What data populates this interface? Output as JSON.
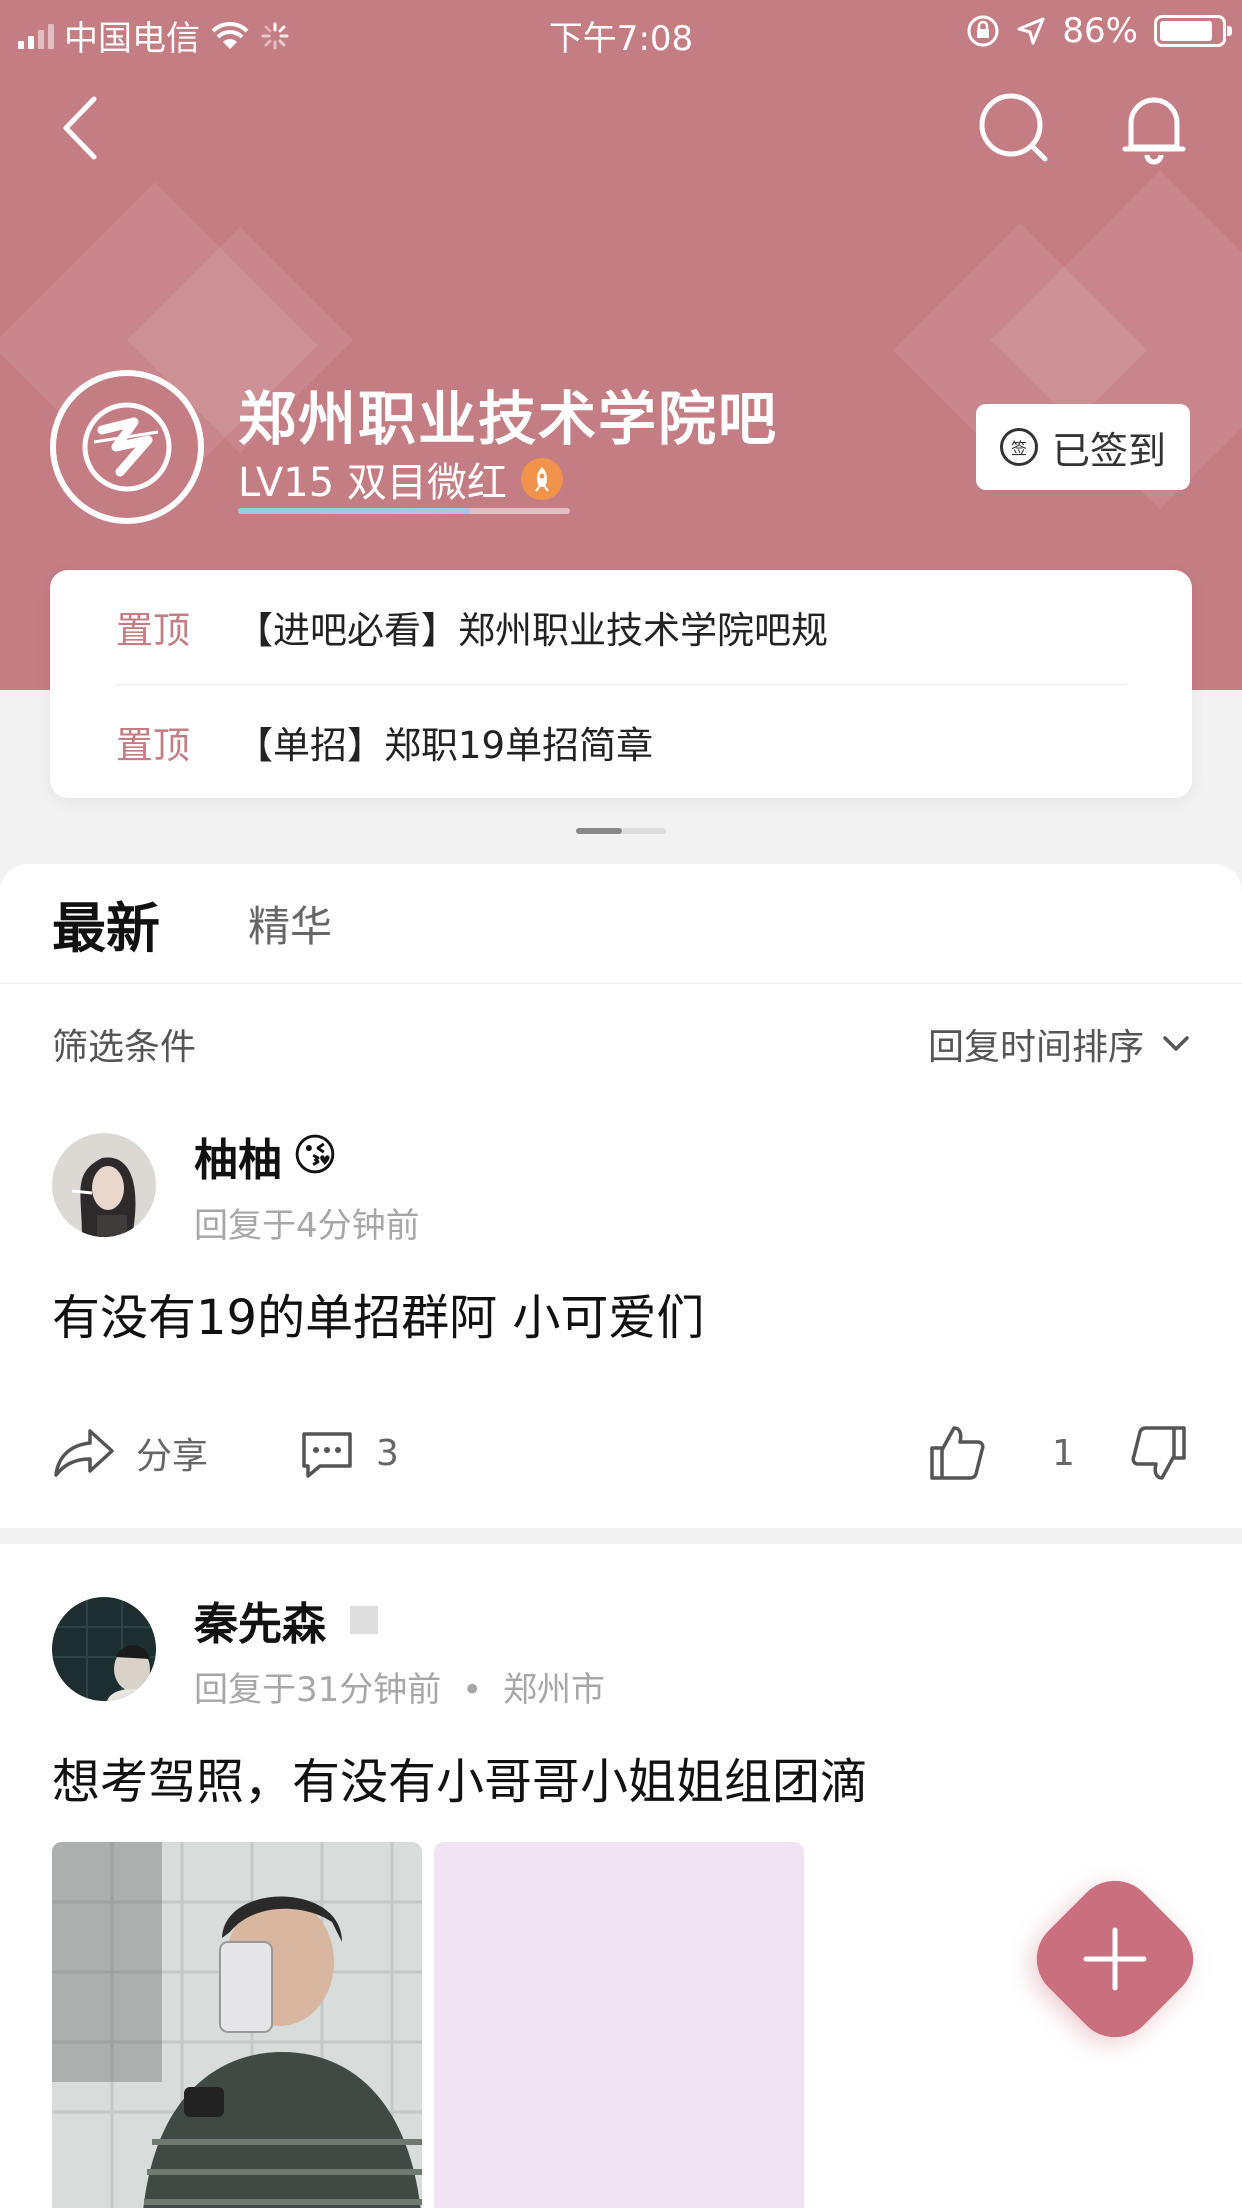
{
  "status_bar": {
    "carrier": "中国电信",
    "time": "下午7:08",
    "battery": "86%",
    "battery_level": 0.86
  },
  "forum": {
    "name": "郑州职业技术学院吧",
    "level": "LV15 双目微红",
    "level_progress": 0.7,
    "checkin_label": "已签到",
    "checkin_icon_char": "签"
  },
  "pinned": [
    {
      "tag": "置顶",
      "text": "【进吧必看】郑州职业技术学院吧规"
    },
    {
      "tag": "置顶",
      "text": "【单招】郑职19单招简章"
    }
  ],
  "tabs": [
    {
      "label": "最新",
      "active": true
    },
    {
      "label": "精华",
      "active": false
    }
  ],
  "filter": {
    "label": "筛选条件",
    "sort_label": "回复时间排序"
  },
  "posts": [
    {
      "username": "柚柚",
      "emoji": "😘",
      "meta": "回复于4分钟前",
      "title": "有没有19的单招群阿 小可爱们",
      "share_label": "分享",
      "comment_count": "3",
      "like_count": "1"
    },
    {
      "username": "秦先森",
      "meta": "回复于31分钟前",
      "location": "郑州市",
      "title": "想考驾照，有没有小哥哥小姐姐组团滴"
    }
  ],
  "colors": {
    "header_bg": "#c57d84",
    "accent": "#c96f7d",
    "pin_tag": "#c57d84"
  }
}
